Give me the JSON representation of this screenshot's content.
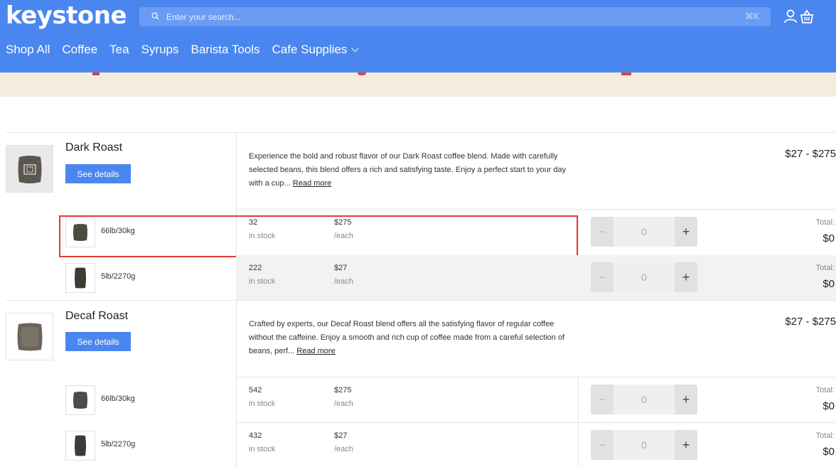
{
  "header": {
    "logo": "keystone",
    "search_placeholder": "Enter your search...",
    "search_shortcut": "⌘K",
    "brand_color": "#4a86f0"
  },
  "nav": {
    "items": [
      "Shop All",
      "Coffee",
      "Tea",
      "Syrups",
      "Barista Tools",
      "Cafe Supplies"
    ]
  },
  "products": [
    {
      "name": "Dark Roast",
      "details_label": "See details",
      "description": "Experience the bold and robust flavor of our Dark Roast coffee blend. Made with carefully selected beans, this blend offers a rich and satisfying taste. Enjoy a perfect start to your day with a cup...",
      "read_more": "Read more",
      "price_range": "$27 - $275",
      "variants": [
        {
          "size": "66lb/30kg",
          "stock": "32",
          "stock_label": "in stock",
          "price": "$275",
          "price_label": "/each",
          "qty": "0",
          "total_label": "Total:",
          "total": "$0"
        },
        {
          "size": "5lb/2270g",
          "stock": "222",
          "stock_label": "in stock",
          "price": "$27",
          "price_label": "/each",
          "qty": "0",
          "total_label": "Total:",
          "total": "$0"
        }
      ]
    },
    {
      "name": "Decaf Roast",
      "details_label": "See details",
      "description": "Crafted by experts, our Decaf Roast blend offers all the satisfying flavor of regular coffee without the caffeine. Enjoy a smooth and rich cup of coffee made from a careful selection of beans, perf...",
      "read_more": "Read more",
      "price_range": "$27 - $275",
      "variants": [
        {
          "size": "66lb/30kg",
          "stock": "542",
          "stock_label": "in stock",
          "price": "$275",
          "price_label": "/each",
          "qty": "0",
          "total_label": "Total:",
          "total": "$0"
        },
        {
          "size": "5lb/2270g",
          "stock": "432",
          "stock_label": "in stock",
          "price": "$27",
          "price_label": "/each",
          "qty": "0",
          "total_label": "Total:",
          "total": "$0"
        }
      ]
    }
  ],
  "qty_controls": {
    "minus": "−",
    "plus": "+"
  }
}
